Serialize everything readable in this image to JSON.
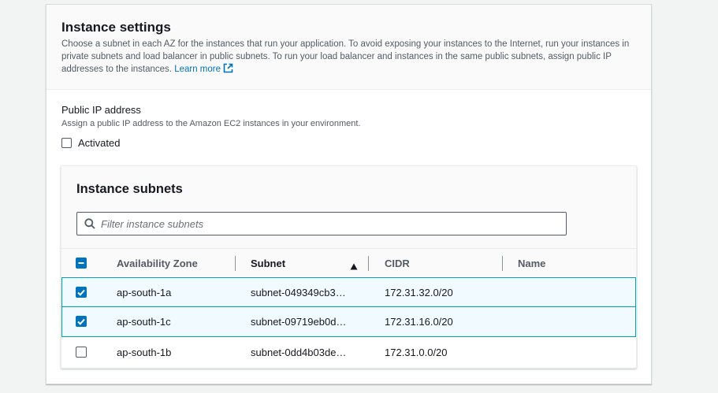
{
  "instance_settings": {
    "title": "Instance settings",
    "description": "Choose a subnet in each AZ for the instances that run your application. To avoid exposing your instances to the Internet, run your instances in private subnets and load balancer in public subnets. To run your load balancer and instances in the same public subnets, assign public IP addresses to the instances.",
    "learn_more": "Learn more",
    "link_color": "#0073bb"
  },
  "public_ip": {
    "label": "Public IP address",
    "description": "Assign a public IP address to the Amazon EC2 instances in your environment.",
    "checkbox_label": "Activated",
    "checked": false
  },
  "instance_subnets": {
    "title": "Instance subnets",
    "filter_placeholder": "Filter instance subnets",
    "filter_value": "",
    "columns": [
      "Availability Zone",
      "Subnet",
      "CIDR",
      "Name"
    ],
    "sorted_column": "Subnet",
    "sort_direction": "ascending",
    "select_all_state": "indeterminate",
    "rows": [
      {
        "az": "ap-south-1a",
        "subnet": "subnet-049349cb3…",
        "cidr": "172.31.32.0/20",
        "name": "",
        "selected": true
      },
      {
        "az": "ap-south-1c",
        "subnet": "subnet-09719eb0d…",
        "cidr": "172.31.16.0/20",
        "name": "",
        "selected": true
      },
      {
        "az": "ap-south-1b",
        "subnet": "subnet-0dd4b03de…",
        "cidr": "172.31.0.0/20",
        "name": "",
        "selected": false
      }
    ]
  },
  "icons": [
    "external-link-icon",
    "search-icon",
    "sort-ascending-icon",
    "checkbox-checked-icon",
    "checkbox-indeterminate-icon"
  ],
  "colors": {
    "selection_accent": "#0073bb",
    "selected_row_border": "#00a1c9",
    "selected_row_bg": "#f1faff"
  }
}
